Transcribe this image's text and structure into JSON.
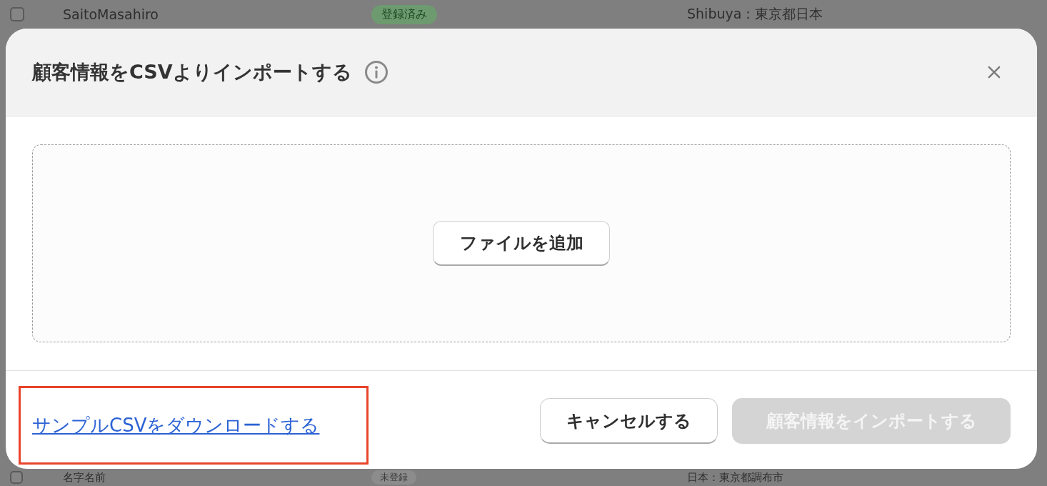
{
  "background_table": {
    "rows": [
      {
        "checked": false,
        "name": "SaitoMasahiro",
        "status": {
          "label": "登録済み",
          "kind": "registered"
        },
        "address": "Shibuya：東京都日本"
      },
      {
        "checked": false,
        "name": "名字名前",
        "status": {
          "label": "未登録",
          "kind": "unregistered"
        },
        "address": "日本：東京都調布市"
      }
    ]
  },
  "dialog": {
    "title": "顧客情報をCSVよりインポートする",
    "dropzone": {
      "button": "ファイルを追加"
    },
    "footer": {
      "link": "サンプルCSVをダウンロードする",
      "link_highlighted": true,
      "buttons": [
        {
          "label": "キャンセルする",
          "kind": "secondary",
          "disabled": false
        },
        {
          "label": "顧客情報をインポートする",
          "kind": "primary",
          "disabled": true
        }
      ]
    }
  }
}
